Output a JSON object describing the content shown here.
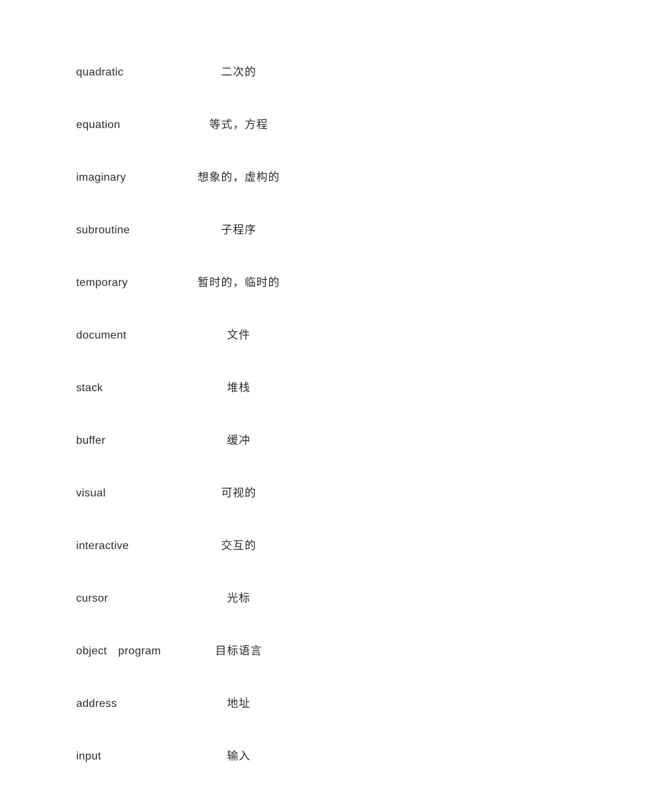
{
  "entries": [
    {
      "term": "quadratic",
      "def": "二次的"
    },
    {
      "term": "equation",
      "def": "等式，方程"
    },
    {
      "term": "imaginary",
      "def": "想象的，虚构的"
    },
    {
      "term": "subroutine",
      "def": "子程序"
    },
    {
      "term": "temporary",
      "def": "暂时的，临时的"
    },
    {
      "term": "document",
      "def": "文件"
    },
    {
      "term": "stack",
      "def": "堆栈"
    },
    {
      "term": "buffer",
      "def": "缓冲"
    },
    {
      "term": "visual",
      "def": "可视的"
    },
    {
      "term": "interactive",
      "def": "交互的"
    },
    {
      "term": "cursor",
      "def": "光标"
    },
    {
      "term": "object program",
      "def": "目标语言"
    },
    {
      "term": "address",
      "def": "地址"
    },
    {
      "term": "input",
      "def": "输入"
    }
  ]
}
